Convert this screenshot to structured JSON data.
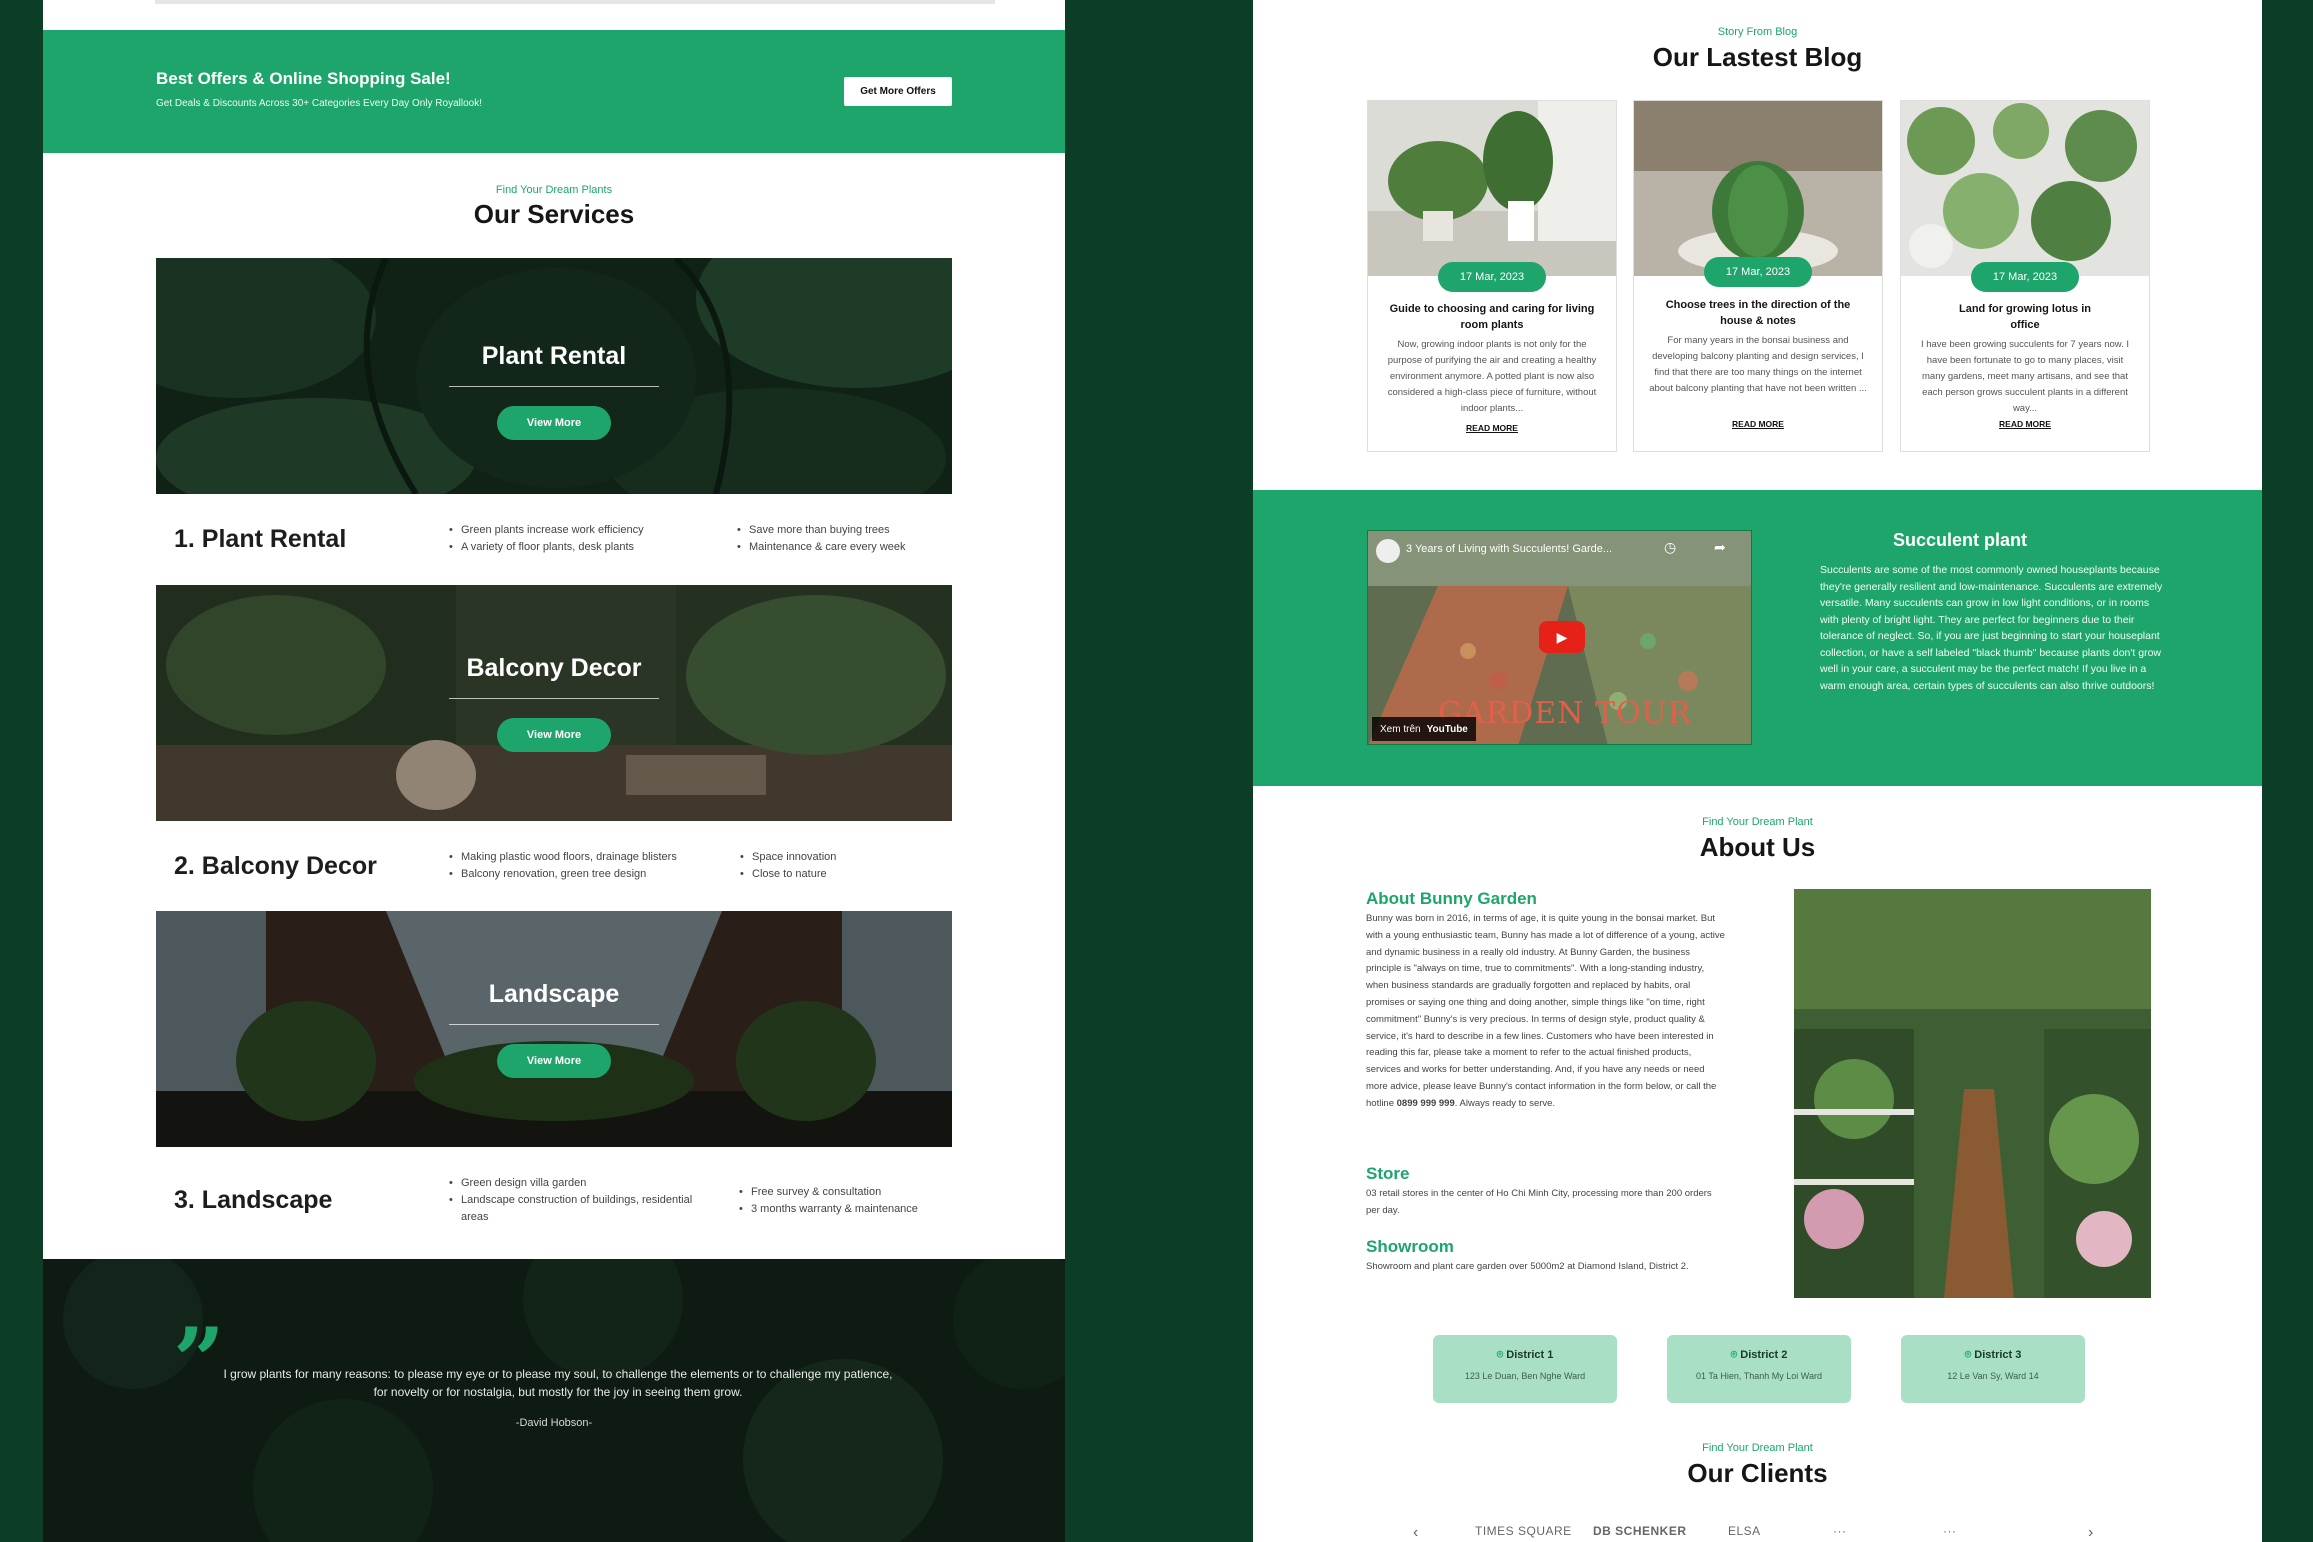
{
  "left": {
    "offers": {
      "title": "Best Offers & Online Shopping Sale!",
      "subtitle": "Get Deals & Discounts Across 30+ Categories Every Day Only Royallook!",
      "button": "Get More Offers"
    },
    "services": {
      "kicker": "Find Your Dream Plants",
      "title": "Our Services",
      "view_more": "View More",
      "items": [
        {
          "image_title": "Plant Rental",
          "name": "1. Plant Rental",
          "col1": [
            "Green plants increase work efficiency",
            "A variety of floor plants, desk plants"
          ],
          "col2": [
            "Save more than buying trees",
            "Maintenance & care every week"
          ]
        },
        {
          "image_title": "Balcony Decor",
          "name": "2. Balcony Decor",
          "col1": [
            "Making plastic wood floors, drainage blisters",
            "Balcony renovation, green tree design"
          ],
          "col2": [
            "Space innovation",
            "Close to nature"
          ]
        },
        {
          "image_title": "Landscape",
          "name": "3. Landscape",
          "col1": [
            "Green design villa garden",
            "Landscape construction of buildings, residential areas"
          ],
          "col2": [
            "Free survey & consultation",
            "3 months warranty & maintenance"
          ]
        }
      ]
    },
    "quote": {
      "text": "I grow plants for many reasons: to please my eye or to please my soul, to challenge the elements or to challenge my patience, for novelty or for nostalgia, but mostly for the joy in seeing them grow.",
      "author": "-David Hobson-"
    }
  },
  "right": {
    "blog": {
      "kicker": "Story From Blog",
      "title": "Our Lastest Blog",
      "read_more": "READ MORE",
      "posts": [
        {
          "date": "17 Mar, 2023",
          "title": "Guide to choosing and caring for living room plants",
          "excerpt": "Now, growing indoor plants is not only for the purpose of purifying the air and creating a healthy environment anymore. A potted plant is now also considered a high-class piece of furniture, without indoor plants..."
        },
        {
          "date": "17 Mar, 2023",
          "title": "Choose trees in the direction of the house & notes",
          "excerpt": "For many years in the bonsai business and developing balcony planting and design services, I find that there are too many things on the internet about balcony planting that have not been written ..."
        },
        {
          "date": "17 Mar, 2023",
          "title": "Land for growing lotus in office",
          "excerpt": "I have been growing succulents for 7 years now. I have been fortunate to go to many places, visit many gardens, meet many artisans, and see that each person grows succulent plants in a different way..."
        }
      ]
    },
    "succulent": {
      "video_title": "3 Years of Living with Succulents! Garde...",
      "video_watch": "Xem trên",
      "video_brand": "YouTube",
      "video_overlay": "GARDEN TOUR",
      "title": "Succulent plant",
      "text": "Succulents are some of the most commonly owned houseplants because they're generally resilient and low-maintenance. Succulents are extremely versatile. Many succulents can grow in low light conditions, or in rooms with plenty of bright light. They are perfect for beginners due to their tolerance of neglect. So, if you are just beginning to start your houseplant collection, or have a self labeled \"black thumb\" because plants don't grow well in your care, a succulent may be the perfect match! If you live in a warm enough area, certain types of succulents can also thrive outdoors!"
    },
    "about": {
      "kicker": "Find Your Dream Plant",
      "title": "About Us",
      "garden_title": "About Bunny Garden",
      "garden_text": "Bunny was born in 2016, in terms of age, it is quite young in the bonsai market. But with a young enthusiastic team, Bunny has made a lot of difference of a young, active and dynamic business in a really old industry. At Bunny Garden, the business principle is \"always on time, true to commitments\". With a long-standing industry, when business standards are gradually forgotten and replaced by habits, oral promises or saying one thing and doing another, simple things like \"on time, right commitment\" Bunny's is very precious. In terms of design style, product quality & service, it's hard to describe in a few lines. Customers who have been interested in reading this far, please take a moment to refer to the actual finished products, services and works for better understanding. And, if you have any needs or need more advice, please leave Bunny's contact information in the form below, or call the hotline",
      "hotline": "0899 999 999",
      "garden_end": ". Always ready to serve.",
      "store_title": "Store",
      "store_text": "03 retail stores in the center of Ho Chi Minh City, processing more than 200 orders per day.",
      "showroom_title": "Showroom",
      "showroom_text": "Showroom and plant care garden over 5000m2 at Diamond Island, District 2.",
      "locations": [
        {
          "name": "District 1",
          "address": "123 Le Duan, Ben Nghe Ward"
        },
        {
          "name": "District 2",
          "address": "01 Ta Hien, Thanh My Loi Ward"
        },
        {
          "name": "District 3",
          "address": "12 Le Van Sy, Ward 14"
        }
      ]
    },
    "clients": {
      "kicker": "Find Your Dream Plant",
      "title": "Our Clients",
      "logos": [
        "TIMES SQUARE",
        "DB SCHENKER",
        "ELSA"
      ]
    }
  },
  "colors": {
    "brand": "#1ea56b",
    "dark_bg": "#0c3d26",
    "location_card": "#a9dfc4"
  }
}
